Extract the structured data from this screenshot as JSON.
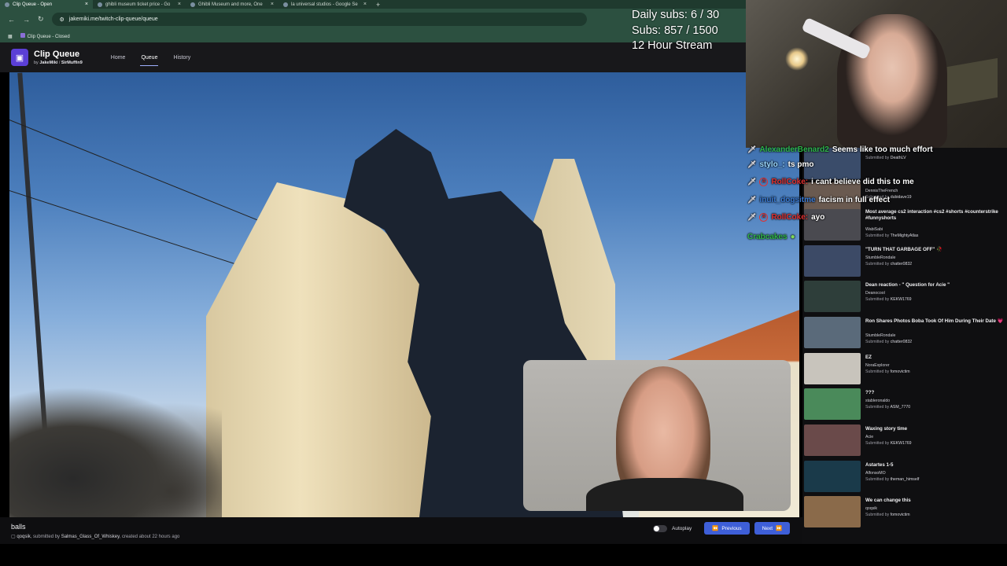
{
  "browser": {
    "tabs": [
      {
        "label": "Clip Queue - Open",
        "active": true
      },
      {
        "label": "ghibli museum ticket price - Go",
        "active": false
      },
      {
        "label": "Ghibli Museum and more, One",
        "active": false
      },
      {
        "label": "la universal studios - Google Se",
        "active": false
      }
    ],
    "new_tab": "+",
    "url": "jakemiki.me/twitch-clip-queue/queue",
    "bookmark": "Clip Queue - Closed"
  },
  "app": {
    "title": "Clip Queue",
    "by": "by",
    "author1": "JakeMiki",
    "sep": "/",
    "author2": "SirMuffin9",
    "nav": [
      "Home",
      "Queue",
      "History"
    ]
  },
  "current_clip": {
    "title": "balls",
    "channel": "qoqsik",
    "submitted_prefix": ", submitted by",
    "submitter": "Salmas_Glass_Of_Whiskey",
    "created": ", created about 22 hours ago"
  },
  "controls": {
    "autoplay": "Autoplay",
    "previous": "Previous",
    "next": "Next"
  },
  "stream_stats": {
    "daily_subs": "Daily subs: 6 / 30",
    "subs": "Subs: 857 / 1500",
    "stream": "12 Hour Stream"
  },
  "chat": [
    {
      "user": "AlexanderBenard2",
      "text": "Seems like too much effort",
      "color": "#2fb54a",
      "badge": "sword"
    },
    {
      "user": "stylo_:",
      "text": "ts pmo",
      "color": "#9ad7ff",
      "badge": "sword"
    },
    {
      "user": "RollCoke:",
      "text": "i cant believe did this to me",
      "color": "#e03030",
      "badge": "mod"
    },
    {
      "user": "inuit_dogsitme",
      "text": "facism in full effect",
      "color": "#3a7bd5",
      "badge": "sword"
    },
    {
      "user": "RollCoke:",
      "text": "ayo",
      "color": "#e03030",
      "badge": "mod"
    },
    {
      "user": "Crabcakes",
      "text": "",
      "color": "#2fb54a",
      "badge": "none"
    }
  ],
  "queue": [
    {
      "title": "",
      "channel": "",
      "submitter": "DeathLV",
      "thumb": "#3a4c6a"
    },
    {
      "title": "",
      "channel": "",
      "submitter": "",
      "thumb": "#5a4a40"
    },
    {
      "title": "",
      "channel": "DennisTheFrench",
      "submitter": "dubidave19",
      "thumb": "#6a5a50"
    },
    {
      "title": "Most average cs2 interaction #cs2 #shorts #counterstrike #funnyshorts",
      "channel": "WabiSabi",
      "submitter": "TheMightyAtlas",
      "thumb": "#4a4a50"
    },
    {
      "title": "\"TURN THAT GARBAGE OFF\" 🥀",
      "channel": "StumbleRondale",
      "submitter": "chatter0832",
      "thumb": "#3c4a66"
    },
    {
      "title": "Dean reaction - \" Question for Acie \"",
      "channel": "Deanocool",
      "submitter": "KEKW1769",
      "thumb": "#2e3e3a"
    },
    {
      "title": "Ron Shares Photos Boba Took Of Him During Their Date 💗",
      "channel": "StumbleRondale",
      "submitter": "chatter0832",
      "thumb": "#5a6a7a"
    },
    {
      "title": "EZ",
      "channel": "NoraExplorer",
      "submitter": "fomovictim",
      "thumb": "#c8c4bc"
    },
    {
      "title": "???",
      "channel": "stableronaldo",
      "submitter": "ASM_7770",
      "thumb": "#4a8a5a"
    },
    {
      "title": "Waxing story time",
      "channel": "Acie",
      "submitter": "KEKW1769",
      "thumb": "#6a4a4a"
    },
    {
      "title": "Astartes 1-5",
      "channel": "AlfonsoMO",
      "submitter": "theman_himself",
      "thumb": "#1a3a4a"
    },
    {
      "title": "We can change this",
      "channel": "qoqsik",
      "submitter": "fomovictim",
      "thumb": "#8a6a4a"
    }
  ],
  "queue_submitted_label": "Submitted by"
}
